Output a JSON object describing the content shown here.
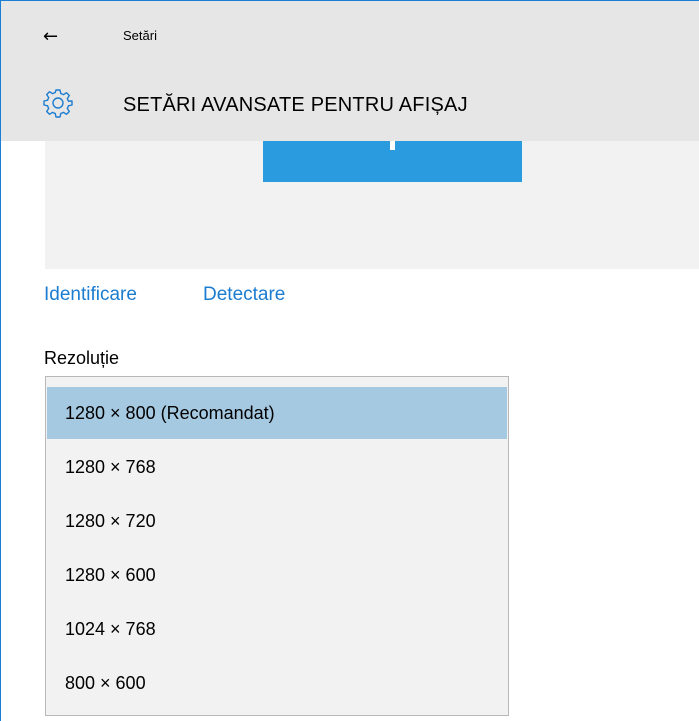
{
  "window": {
    "app_title": "Setări",
    "back_glyph": "←",
    "back_icon": "back-arrow-icon"
  },
  "header": {
    "page_title": "SETĂRI AVANSATE PENTRU AFIȘAJ",
    "icon": "gear-icon"
  },
  "links": {
    "identify": "Identificare",
    "detect": "Detectare"
  },
  "resolution": {
    "label": "Rezoluție",
    "selected_index": 0,
    "options": [
      "1280 × 800 (Recomandat)",
      "1280 × 768",
      "1280 × 720",
      "1280 × 600",
      "1024 × 768",
      "800 × 600"
    ]
  },
  "colors": {
    "accent": "#2b9be0",
    "link": "#1c7cd0",
    "selected_option": "#a6c9e2",
    "header_bg": "#e6e6e6"
  }
}
